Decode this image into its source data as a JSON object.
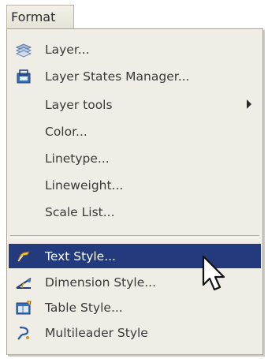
{
  "menubar": {
    "title": "Format"
  },
  "menu": {
    "items": [
      {
        "id": "layer",
        "label": "Layer...",
        "icon": "layers-icon"
      },
      {
        "id": "layer-states-manager",
        "label": "Layer States Manager...",
        "icon": "layer-states-icon"
      },
      {
        "id": "layer-tools",
        "label": "Layer tools",
        "submenu": true
      },
      {
        "id": "color",
        "label": "Color..."
      },
      {
        "id": "linetype",
        "label": "Linetype..."
      },
      {
        "id": "lineweight",
        "label": "Lineweight..."
      },
      {
        "id": "scale-list",
        "label": "Scale List..."
      },
      {
        "id": "text-style",
        "label": "Text Style...",
        "icon": "text-style-icon",
        "highlighted": true
      },
      {
        "id": "dimension-style",
        "label": "Dimension Style...",
        "icon": "dimension-style-icon"
      },
      {
        "id": "table-style",
        "label": "Table Style...",
        "icon": "table-style-icon"
      },
      {
        "id": "multileader-style",
        "label": "Multileader Style",
        "icon": "multileader-style-icon"
      }
    ]
  },
  "colors": {
    "menu_bg": "#efede5",
    "highlight": "#233a7c",
    "text": "#3a3a3a"
  }
}
